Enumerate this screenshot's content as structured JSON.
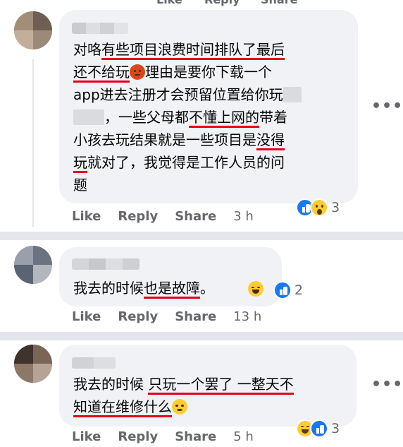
{
  "top_actions": {
    "like": "Like",
    "reply": "Reply",
    "share": "Share"
  },
  "comments": [
    {
      "lines": [
        [
          "对咯",
          "有些项目浪费时间排队了最后",
          ""
        ],
        [
          "还不给玩",
          "理由是要你下载一个",
          ""
        ],
        [
          "app进去注册才会预留位置给你玩",
          "",
          ""
        ],
        [
          "，一些父母都",
          "不懂上网的",
          "带着"
        ],
        [
          "小孩去玩结果就是一些项目是",
          "没得",
          ""
        ],
        [
          "玩",
          "就对了，我觉得是工作人员的问",
          ""
        ],
        [
          "题",
          "",
          ""
        ]
      ],
      "actions": {
        "like": "Like",
        "reply": "Reply",
        "share": "Share",
        "time": "3 h"
      },
      "reactions": [
        "like-icon",
        "wow-icon"
      ],
      "reaction_count": "3"
    },
    {
      "text_plain": "我去的时候",
      "text_underlined": "也是故障",
      "text_after": "。",
      "actions": {
        "like": "Like",
        "reply": "Reply",
        "share": "Share",
        "time": "13 h"
      },
      "reactions": [
        "like-icon"
      ],
      "reaction_count": "2"
    },
    {
      "line1_plain": "我去的时候 ",
      "line1_underlined": "只玩一个罢了 一整天不",
      "line2_underlined": "知道在维修什么",
      "actions": {
        "like": "Like",
        "reply": "Reply",
        "share": "Share",
        "time": "5 h"
      },
      "reactions": [
        "haha-icon",
        "like-icon"
      ],
      "reaction_count": "3"
    }
  ],
  "more_label": "•••"
}
